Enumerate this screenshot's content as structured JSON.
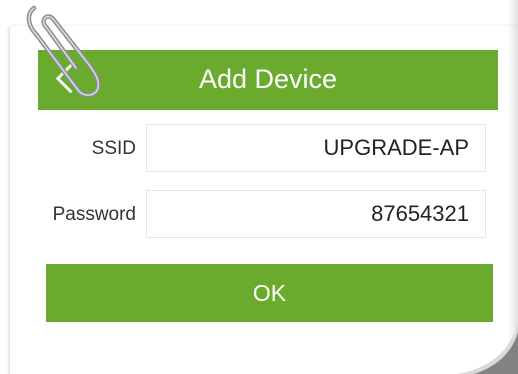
{
  "header": {
    "title": "Add Device"
  },
  "form": {
    "ssid_label": "SSID",
    "ssid_value": "UPGRADE-AP",
    "password_label": "Password",
    "password_value": "87654321"
  },
  "actions": {
    "ok_label": "OK"
  },
  "icons": {
    "back": "chevron-left-icon",
    "clip": "paperclip-icon"
  },
  "colors": {
    "accent": "#6aab2e",
    "text": "#333333",
    "border": "#e3e3e3"
  }
}
